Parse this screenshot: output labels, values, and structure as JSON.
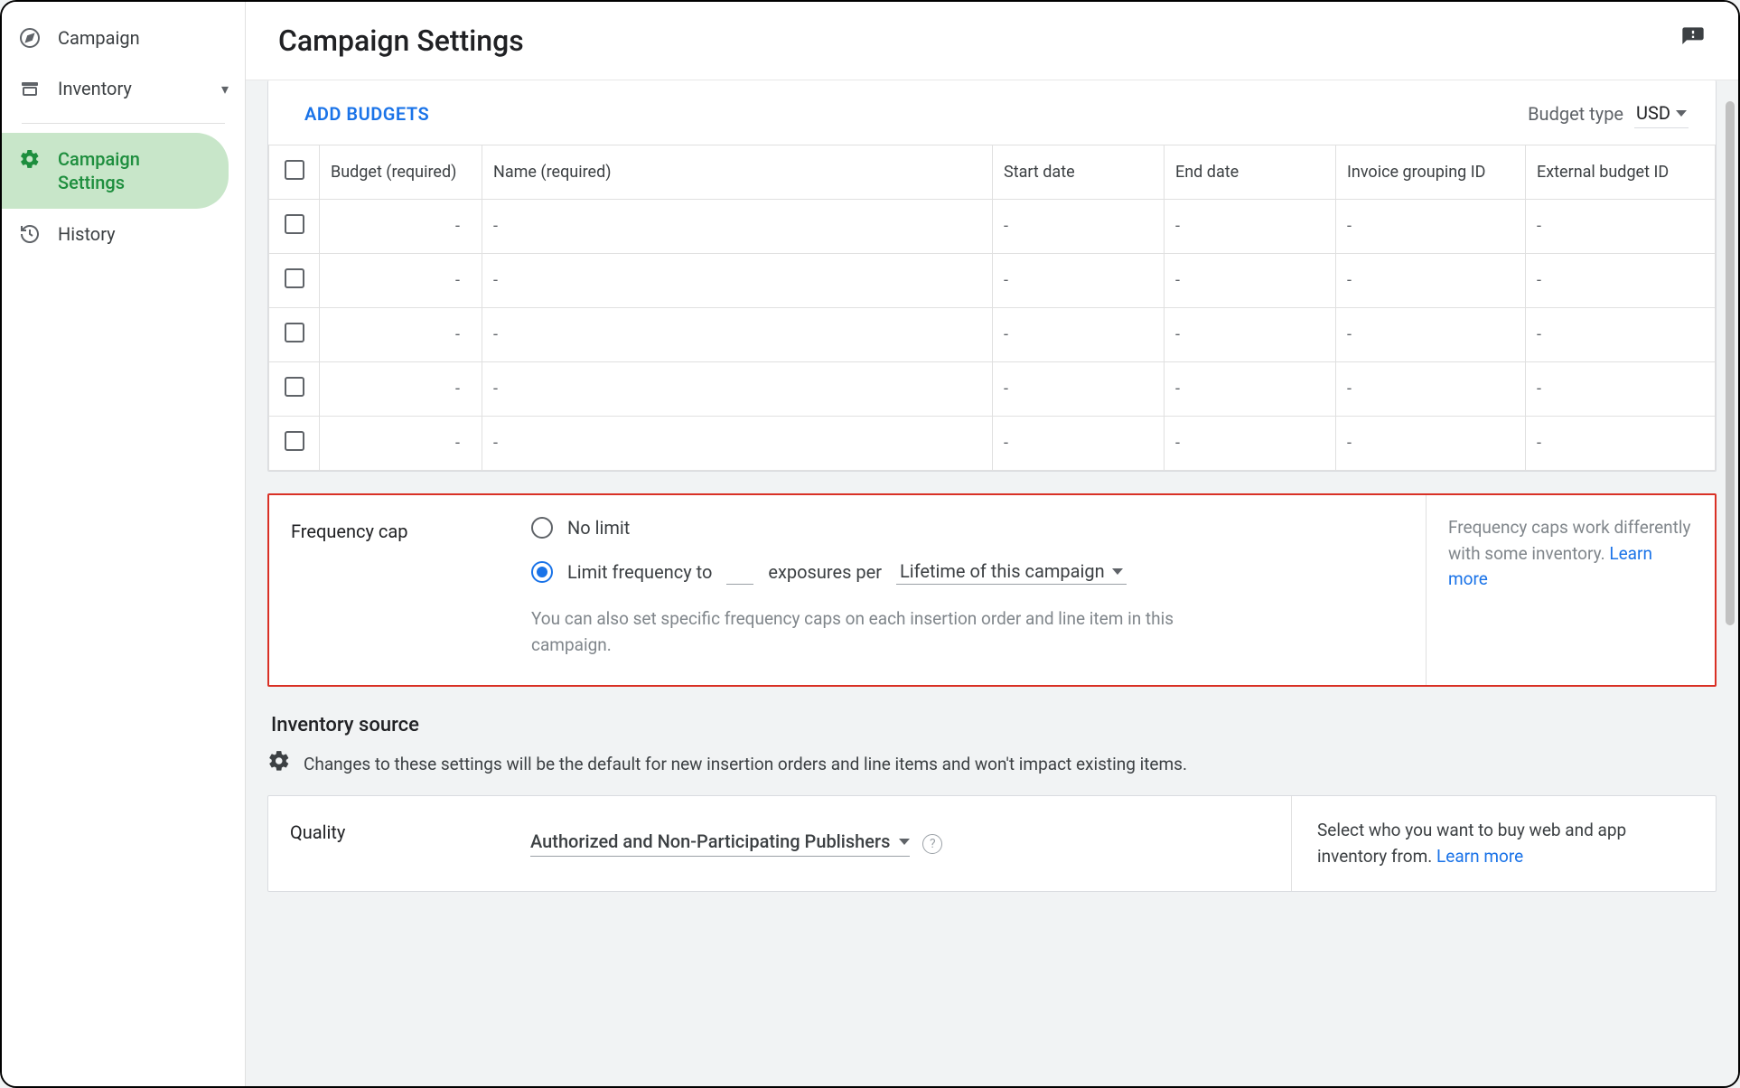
{
  "sidebar": {
    "items": [
      {
        "label": "Campaign",
        "icon": "compass-icon"
      },
      {
        "label": "Inventory",
        "icon": "archive-icon",
        "chevron": true
      },
      {
        "label": "Campaign\nSettings",
        "icon": "gear-icon",
        "active": true
      },
      {
        "label": "History",
        "icon": "history-icon"
      }
    ]
  },
  "header": {
    "title": "Campaign Settings"
  },
  "budgets": {
    "add_label": "ADD BUDGETS",
    "type_label": "Budget type",
    "type_value": "USD",
    "columns": [
      "Budget (required)",
      "Name (required)",
      "Start date",
      "End date",
      "Invoice grouping ID",
      "External budget ID"
    ],
    "rows": [
      [
        "-",
        "-",
        "-",
        "-",
        "-",
        "-"
      ],
      [
        "-",
        "-",
        "-",
        "-",
        "-",
        "-"
      ],
      [
        "-",
        "-",
        "-",
        "-",
        "-",
        "-"
      ],
      [
        "-",
        "-",
        "-",
        "-",
        "-",
        "-"
      ],
      [
        "-",
        "-",
        "-",
        "-",
        "-",
        "-"
      ]
    ]
  },
  "frequency": {
    "title": "Frequency cap",
    "no_limit": "No limit",
    "limit_prefix": "Limit frequency to",
    "limit_value": "",
    "limit_mid": "exposures per",
    "period": "Lifetime of this campaign",
    "hint": "You can also set specific frequency caps on each insertion order and line item in this campaign.",
    "side_text": "Frequency caps work differently with some inventory.",
    "learn_more": "Learn more"
  },
  "inventory": {
    "title": "Inventory source",
    "note": "Changes to these settings will be the default for new insertion orders and line items and won't impact existing items.",
    "quality_label": "Quality",
    "quality_value": "Authorized and Non-Participating Publishers",
    "quality_side": "Select who you want to buy web and app inventory from.",
    "learn_more": "Learn more"
  }
}
